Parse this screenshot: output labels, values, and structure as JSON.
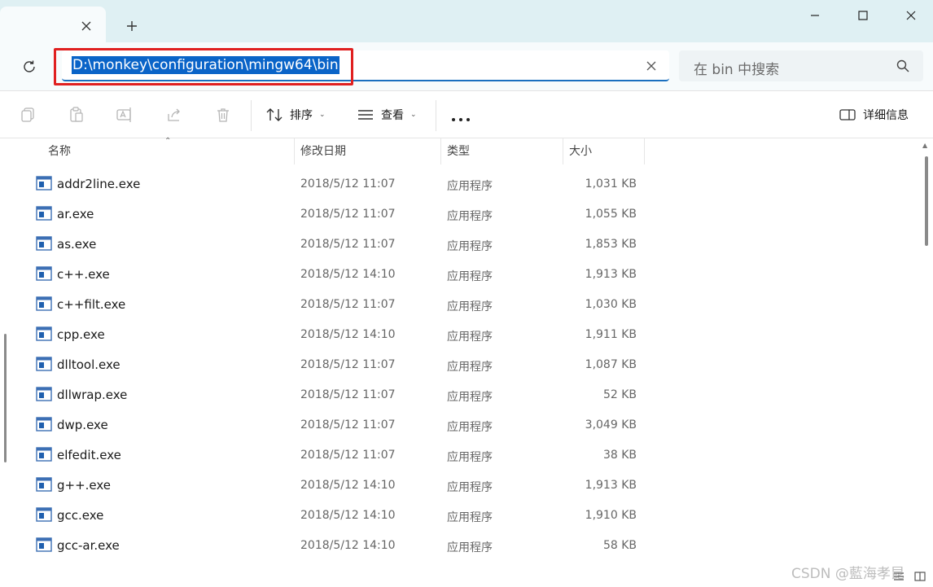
{
  "window": {
    "minimize_icon": "minimize-icon",
    "maximize_icon": "maximize-icon",
    "close_icon": "close-icon"
  },
  "tab": {
    "close_icon": "close-icon",
    "new_tab_icon": "plus-icon"
  },
  "address": {
    "path": "D:\\monkey\\configuration\\mingw64\\bin",
    "clear_icon": "close-icon",
    "refresh_icon": "refresh-icon",
    "highlight_color": "#e02020",
    "selection_color": "#0a64c8"
  },
  "search": {
    "placeholder": "在 bin 中搜索",
    "icon": "search-icon"
  },
  "toolbar": {
    "icons": [
      "copy-icon",
      "paste-icon",
      "rename-icon",
      "share-icon",
      "delete-icon"
    ],
    "sort_label": "排序",
    "view_label": "查看",
    "more_label": "...",
    "details_label": "详细信息"
  },
  "columns": {
    "name": "名称",
    "date": "修改日期",
    "type": "类型",
    "size": "大小"
  },
  "files": [
    {
      "name": "addr2line.exe",
      "date": "2018/5/12 11:07",
      "type": "应用程序",
      "size": "1,031 KB"
    },
    {
      "name": "ar.exe",
      "date": "2018/5/12 11:07",
      "type": "应用程序",
      "size": "1,055 KB"
    },
    {
      "name": "as.exe",
      "date": "2018/5/12 11:07",
      "type": "应用程序",
      "size": "1,853 KB"
    },
    {
      "name": "c++.exe",
      "date": "2018/5/12 14:10",
      "type": "应用程序",
      "size": "1,913 KB"
    },
    {
      "name": "c++filt.exe",
      "date": "2018/5/12 11:07",
      "type": "应用程序",
      "size": "1,030 KB"
    },
    {
      "name": "cpp.exe",
      "date": "2018/5/12 14:10",
      "type": "应用程序",
      "size": "1,911 KB"
    },
    {
      "name": "dlltool.exe",
      "date": "2018/5/12 11:07",
      "type": "应用程序",
      "size": "1,087 KB"
    },
    {
      "name": "dllwrap.exe",
      "date": "2018/5/12 11:07",
      "type": "应用程序",
      "size": "52 KB"
    },
    {
      "name": "dwp.exe",
      "date": "2018/5/12 11:07",
      "type": "应用程序",
      "size": "3,049 KB"
    },
    {
      "name": "elfedit.exe",
      "date": "2018/5/12 11:07",
      "type": "应用程序",
      "size": "38 KB"
    },
    {
      "name": "g++.exe",
      "date": "2018/5/12 14:10",
      "type": "应用程序",
      "size": "1,913 KB"
    },
    {
      "name": "gcc.exe",
      "date": "2018/5/12 14:10",
      "type": "应用程序",
      "size": "1,910 KB"
    },
    {
      "name": "gcc-ar.exe",
      "date": "2018/5/12 14:10",
      "type": "应用程序",
      "size": "58 KB"
    }
  ],
  "watermark": "CSDN @藍海孝昆"
}
